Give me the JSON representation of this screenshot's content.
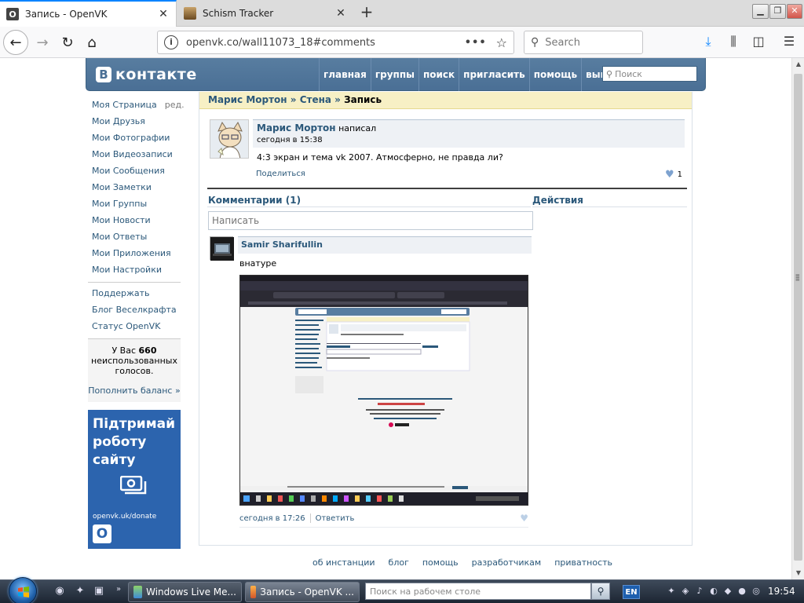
{
  "browser": {
    "tabs": [
      {
        "title": "Запись - OpenVK",
        "favicon": "O",
        "active": true
      },
      {
        "title": "Schism Tracker",
        "favicon": "",
        "active": false
      }
    ],
    "url": "openvk.co/wall11073_18#comments",
    "search_placeholder": "Search"
  },
  "vk": {
    "logo_badge": "B",
    "logo_word": "контакте",
    "nav": [
      "главная",
      "группы",
      "поиск",
      "пригласить",
      "помощь",
      "выйти"
    ],
    "search_placeholder": "Поиск",
    "left_menu": {
      "group1": [
        "Моя Страница",
        "Мои Друзья",
        "Мои Фотографии",
        "Мои Видеозаписи",
        "Мои Сообщения",
        "Мои Заметки",
        "Мои Группы",
        "Мои Новости",
        "Мои Ответы",
        "Мои Приложения",
        "Мои Настройки"
      ],
      "edit_label": "ред.",
      "group2": [
        "Поддержать",
        "Блог Веселкрафта",
        "Статус OpenVK"
      ]
    },
    "balance": {
      "prefix": "У Вас",
      "amount": "660",
      "suffix": "неиспользованных голосов.",
      "topup": "Пополнить баланс »"
    },
    "donate": {
      "line1": "Підтримай",
      "line2": "роботу",
      "line3": "сайту",
      "url": "openvk.uk/donate",
      "logo": "O"
    },
    "breadcrumb": {
      "part1": "Марис Мортон",
      "sep": " » ",
      "part2": "Стена",
      "current": "Запись"
    },
    "post": {
      "author": "Марис Мортон",
      "wrote": "написал",
      "date": "сегодня в 15:38",
      "text": "4:3 экран и тема vk 2007. Атмосферно, не правда ли?",
      "share": "Поделиться",
      "likes": "1"
    },
    "comments_title": "Комментарии (1)",
    "actions_title": "Действия",
    "comment_placeholder": "Написать",
    "comment": {
      "author": "Samir Sharifullin",
      "text": "внатуре",
      "date": "сегодня в 17:26",
      "reply": "Ответить"
    },
    "footer_links": [
      "об инстанции",
      "блог",
      "помощь",
      "разработчикам",
      "приватность"
    ]
  },
  "taskbar": {
    "buttons": [
      "Windows Live Me...",
      "Запись - OpenVK ..."
    ],
    "search_placeholder": "Поиск на рабочем столе",
    "lang": "EN",
    "clock": "19:54"
  },
  "colors": {
    "vk_header": "#4a6f95",
    "vk_link": "#2b587a",
    "donate_bg": "#2c64ae",
    "breadcrumb_bg": "#f7f0c5"
  }
}
